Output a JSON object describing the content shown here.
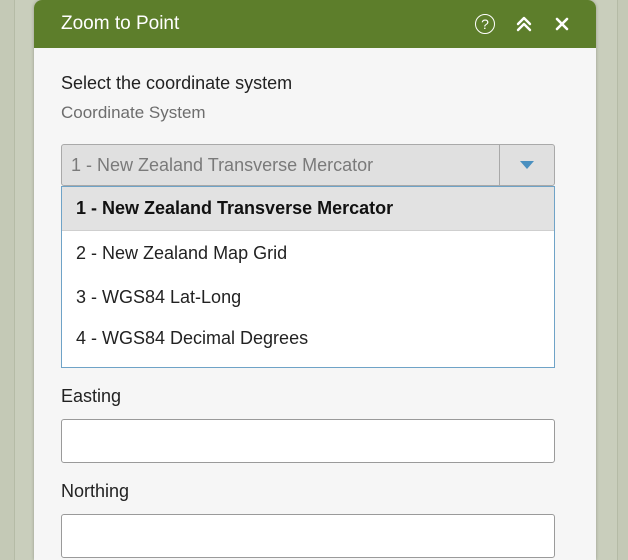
{
  "panel": {
    "title": "Zoom to Point",
    "help_glyph": "?",
    "icons": [
      "help-icon",
      "collapse-icon",
      "close-icon"
    ],
    "header_color": "#5d7e2b"
  },
  "form": {
    "instruction": "Select the coordinate system",
    "coord_label": "Coordinate System",
    "selected_value": "1 - New Zealand Transverse Mercator",
    "options": [
      "1 - New Zealand Transverse Mercator",
      "2 - New Zealand Map Grid",
      "3 - WGS84 Lat-Long",
      "4 - WGS84 Decimal Degrees"
    ],
    "easting_label": "Easting",
    "easting_value": "",
    "northing_label": "Northing",
    "northing_value": ""
  }
}
